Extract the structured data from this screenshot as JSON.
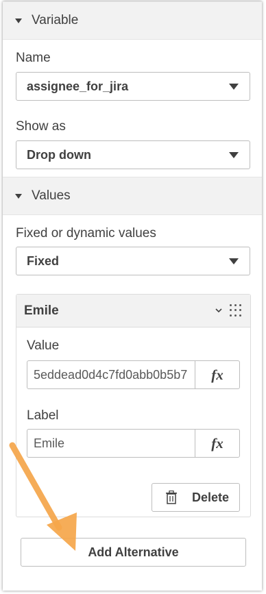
{
  "variable_section": {
    "title": "Variable"
  },
  "name_field": {
    "label": "Name",
    "value": "assignee_for_jira"
  },
  "show_as_field": {
    "label": "Show as",
    "value": "Drop down"
  },
  "values_section": {
    "title": "Values"
  },
  "fixed_dynamic_field": {
    "label": "Fixed or dynamic values",
    "value": "Fixed"
  },
  "alternative": {
    "title": "Emile",
    "value_label": "Value",
    "value": "5eddead0d4c7fd0abb0b5b7",
    "label_label": "Label",
    "label_value": "Emile",
    "fx_label": "fx",
    "delete_label": "Delete"
  },
  "add_alternative_label": "Add Alternative",
  "colors": {
    "arrow": "#f5a64a",
    "text": "#404040",
    "header_bg": "#f2f2f2"
  }
}
